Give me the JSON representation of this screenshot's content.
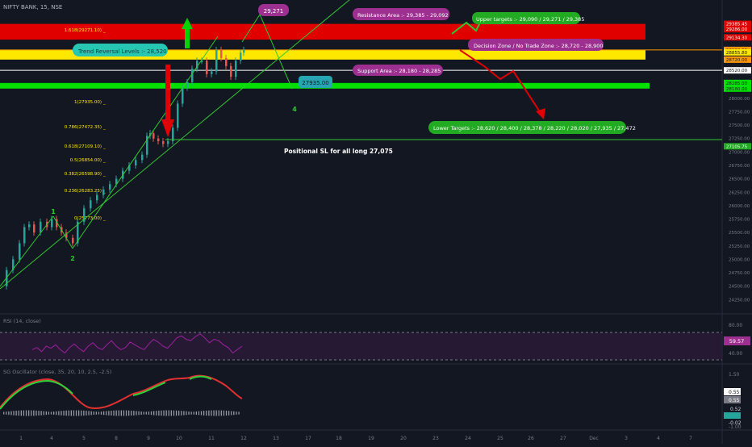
{
  "header": {
    "symbol": "NIFTY BANK, 15, NSE"
  },
  "colors": {
    "bg": "#131722",
    "red_band": "#e00000",
    "yellow_band": "#ffe800",
    "green_band": "#00e000",
    "up": "#26a69a",
    "down": "#ef5350",
    "fib": "#ffe800",
    "wave": "#31c631",
    "rsi": "#a020a0",
    "purple_label": "#9c2f8f",
    "green_label": "#22aa22",
    "teal_label": "#26c6b3"
  },
  "chart_data": {
    "type": "line",
    "title": "NIFTY BANK, 15, NSE",
    "ylim": [
      24000,
      29800
    ],
    "x_ticks": [
      "1",
      "4",
      "5",
      "8",
      "9",
      "10",
      "11",
      "12",
      "13",
      "17",
      "18",
      "19",
      "20",
      "23",
      "24",
      "25",
      "26",
      "27",
      "Dec",
      "3",
      "4",
      "7"
    ],
    "y_ticks": [
      24250,
      24500,
      24750,
      25000,
      25250,
      25500,
      25750,
      26000,
      26250,
      26500,
      26750,
      27000,
      27250,
      27500,
      27750,
      28000
    ],
    "price_path": {
      "x": [
        0,
        8,
        16,
        24,
        30,
        36,
        42,
        50,
        58,
        64,
        70,
        76,
        82,
        90,
        96,
        104,
        112,
        120,
        128,
        136,
        144,
        152,
        160,
        168,
        176,
        182,
        186,
        190,
        196,
        202,
        208,
        214,
        220,
        226,
        232,
        238,
        244,
        250,
        256,
        262,
        268,
        274,
        280,
        286,
        292,
        298,
        302
      ],
      "y": [
        24500,
        24800,
        25000,
        25300,
        25600,
        25650,
        25500,
        25700,
        25600,
        25750,
        25600,
        25500,
        25400,
        25300,
        25700,
        25950,
        26100,
        26200,
        26300,
        26400,
        26500,
        26650,
        26750,
        26850,
        26950,
        27300,
        27350,
        27250,
        27200,
        27150,
        27200,
        27450,
        27900,
        28200,
        28300,
        28550,
        28700,
        28700,
        28450,
        28500,
        28900,
        28750,
        28600,
        28400,
        28700,
        28850,
        28900
      ]
    },
    "wave_labels": [
      {
        "label": "1",
        "x": 66,
        "y": 25850
      },
      {
        "label": "2",
        "x": 90,
        "y": 24980
      },
      {
        "label": "4",
        "x": 365,
        "y": 27760
      }
    ],
    "fib_levels": [
      {
        "label": "1.618(29271.10)",
        "value": 29271.1
      },
      {
        "label": "1(27935.00)",
        "value": 27935
      },
      {
        "label": "0.786(27472.35)",
        "value": 27472.35
      },
      {
        "label": "0.618(27109.10)",
        "value": 27109.1
      },
      {
        "label": "0.5(26854.00)",
        "value": 26854
      },
      {
        "label": "0.382(26598.90)",
        "value": 26598.9
      },
      {
        "label": "0.236(26283.25)",
        "value": 26283.25
      },
      {
        "label": "0(25773.00)",
        "value": 25773
      }
    ],
    "zones": [
      {
        "name": "resistance",
        "from": 29092,
        "to": 29385
      },
      {
        "name": "decision",
        "from": 28720,
        "to": 28900
      },
      {
        "name": "support",
        "from": 28180,
        "to": 28285
      }
    ],
    "price_tags": [
      "29385.45",
      "29286.00",
      "29134.30",
      "28900.00",
      "28855.80",
      "28720.00",
      "28520.00",
      "28285.00",
      "28180.00",
      "27105.75"
    ],
    "annotations": {
      "target_bubble": "29,271",
      "wave4_bubble": "27935.00",
      "resistance": "Resistance Area :- 29,385 - 29,092",
      "upper_targets": "Upper targets :- 29,090 / 29,271 / 29,385",
      "decision": "Decision Zone / No Trade Zone :- 28,720 - 28,900",
      "trend_reversal": "Trend Reversal Levels :- 28,520",
      "support": "Support Area :- 28,180 - 28,285",
      "lower_targets": "Lower Targets :- 28,620 / 28,400 / 28,378 / 28,220 / 28,020 / 27,935 / 27,472",
      "positional_sl": "Positional SL for all long 27,075"
    },
    "rsi": {
      "label": "RSI (14, close)",
      "value": "59.57",
      "ticks": [
        "80.00",
        "40.00"
      ],
      "series": [
        55,
        58,
        52,
        60,
        57,
        62,
        55,
        50,
        58,
        63,
        57,
        52,
        60,
        65,
        58,
        55,
        62,
        68,
        60,
        55,
        58,
        66,
        62,
        58,
        55,
        63,
        70,
        66,
        60,
        57,
        64,
        72,
        75,
        70,
        68,
        74,
        78,
        72,
        65,
        70,
        68,
        62,
        58,
        50,
        55,
        60
      ]
    },
    "sg": {
      "label": "SG Oscillator (close, 35, 20, 10, 2.5, -2.5)",
      "tags": [
        "0.55",
        "0.55",
        "0.52",
        "-0.02"
      ],
      "ticks": [
        "1.50",
        "-1.00"
      ]
    }
  }
}
